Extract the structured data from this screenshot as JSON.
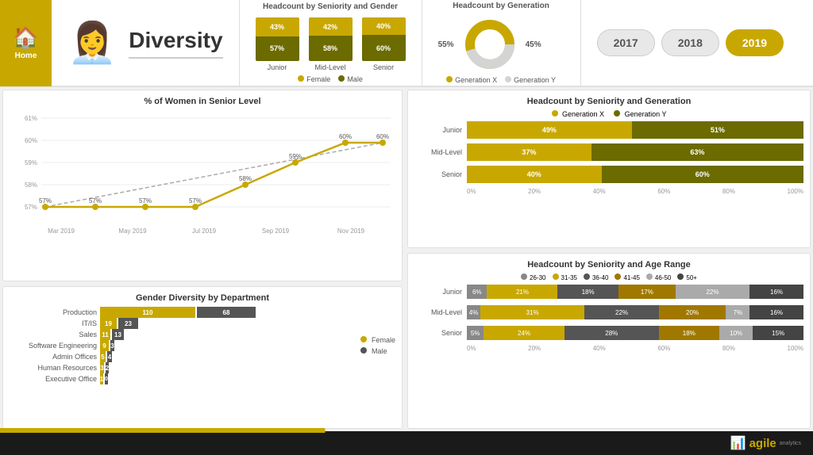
{
  "header": {
    "home_label": "Home",
    "title": "Diversity"
  },
  "headcount_seniority": {
    "title": "Headcount by Seniority and Gender",
    "bars": [
      {
        "label": "Junior",
        "female": "43%",
        "male": "57%",
        "female_pct": 43,
        "male_pct": 57
      },
      {
        "label": "Mid-Level",
        "female": "42%",
        "male": "58%",
        "female_pct": 42,
        "male_pct": 58
      },
      {
        "label": "Senior",
        "female": "40%",
        "male": "60%",
        "female_pct": 40,
        "male_pct": 60
      }
    ],
    "legend_female": "Female",
    "legend_male": "Male"
  },
  "headcount_generation": {
    "title": "Headcount by Generation",
    "gen_x_pct": 55,
    "gen_y_pct": 45,
    "gen_x_label": "55%",
    "gen_y_label": "45%",
    "legend_x": "Generation X",
    "legend_y": "Generation Y"
  },
  "years": {
    "options": [
      "2017",
      "2018",
      "2019"
    ],
    "active": "2019"
  },
  "women_senior": {
    "title": "% of Women in Senior Level",
    "y_labels": [
      "61%",
      "60%",
      "59%",
      "58%",
      "57%"
    ],
    "x_labels": [
      "Mar 2019",
      "May 2019",
      "Jul 2019",
      "Sep 2019",
      "Nov 2019"
    ],
    "data_points": [
      {
        "x": 0,
        "y": 56.5,
        "label": "57%"
      },
      {
        "x": 1,
        "y": 57.0,
        "label": "57%"
      },
      {
        "x": 2,
        "y": 57.0,
        "label": "57%"
      },
      {
        "x": 3,
        "y": 57.0,
        "label": "57%"
      },
      {
        "x": 4,
        "y": 58.0,
        "label": "58%"
      },
      {
        "x": 5,
        "y": 59.0,
        "label": "59%"
      },
      {
        "x": 6,
        "y": 60.0,
        "label": "60%"
      },
      {
        "x": 7,
        "y": 60.0,
        "label": "60%"
      }
    ]
  },
  "gender_dept": {
    "title": "Gender Diversity by Department",
    "legend_female": "Female",
    "legend_male": "Male",
    "departments": [
      {
        "name": "Production",
        "female": 110,
        "male": 68
      },
      {
        "name": "IT/IS",
        "female": 19,
        "male": 23
      },
      {
        "name": "Sales",
        "female": 11,
        "male": 13
      },
      {
        "name": "Software Engineering",
        "female": 9,
        "male": 3
      },
      {
        "name": "Admin Offices",
        "female": 5,
        "male": 4
      },
      {
        "name": "Human Resources",
        "female": 3,
        "male": 2
      },
      {
        "name": "Executive Office",
        "female": 1,
        "male": 0
      }
    ],
    "max_val": 180
  },
  "seniority_gen": {
    "title": "Headcount by Seniority and Generation",
    "legend_x": "Generation X",
    "legend_y": "Generation Y",
    "rows": [
      {
        "label": "Junior",
        "x_pct": 49,
        "y_pct": 51,
        "x_label": "49%",
        "y_label": "51%"
      },
      {
        "label": "Mid-Level",
        "x_pct": 37,
        "y_pct": 63,
        "x_label": "37%",
        "y_label": "63%"
      },
      {
        "label": "Senior",
        "x_pct": 40,
        "y_pct": 60,
        "x_label": "40%",
        "y_label": "60%"
      }
    ]
  },
  "age_range": {
    "title": "Headcount by Seniority and Age Range",
    "legend": [
      {
        "label": "26-30",
        "color": "#888"
      },
      {
        "label": "31-35",
        "color": "#c8a800"
      },
      {
        "label": "36-40",
        "color": "#555"
      },
      {
        "label": "41-45",
        "color": "#a07800"
      },
      {
        "label": "46-50",
        "color": "#aaa"
      },
      {
        "label": "50+",
        "color": "#444"
      }
    ],
    "rows": [
      {
        "label": "Junior",
        "segs": [
          {
            "pct": 6,
            "label": "6%",
            "color": "#888"
          },
          {
            "pct": 21,
            "label": "21%",
            "color": "#c8a800"
          },
          {
            "pct": 18,
            "label": "18%",
            "color": "#555"
          },
          {
            "pct": 17,
            "label": "17%",
            "color": "#a07800"
          },
          {
            "pct": 22,
            "label": "22%",
            "color": "#aaa"
          },
          {
            "pct": 16,
            "label": "16%",
            "color": "#444"
          }
        ]
      },
      {
        "label": "Mid-Level",
        "segs": [
          {
            "pct": 4,
            "label": "4%",
            "color": "#888"
          },
          {
            "pct": 31,
            "label": "31%",
            "color": "#c8a800"
          },
          {
            "pct": 22,
            "label": "22%",
            "color": "#555"
          },
          {
            "pct": 20,
            "label": "20%",
            "color": "#a07800"
          },
          {
            "pct": 7,
            "label": "7%",
            "color": "#aaa"
          },
          {
            "pct": 16,
            "label": "16%",
            "color": "#444"
          }
        ]
      },
      {
        "label": "Senior",
        "segs": [
          {
            "pct": 5,
            "label": "5%",
            "color": "#888"
          },
          {
            "pct": 24,
            "label": "24%",
            "color": "#c8a800"
          },
          {
            "pct": 28,
            "label": "28%",
            "color": "#555"
          },
          {
            "pct": 18,
            "label": "18%",
            "color": "#a07800"
          },
          {
            "pct": 10,
            "label": "10%",
            "color": "#aaa"
          },
          {
            "pct": 15,
            "label": "15%",
            "color": "#444"
          }
        ]
      }
    ]
  },
  "footer": {
    "logo": "agile",
    "sub": "analytics"
  }
}
